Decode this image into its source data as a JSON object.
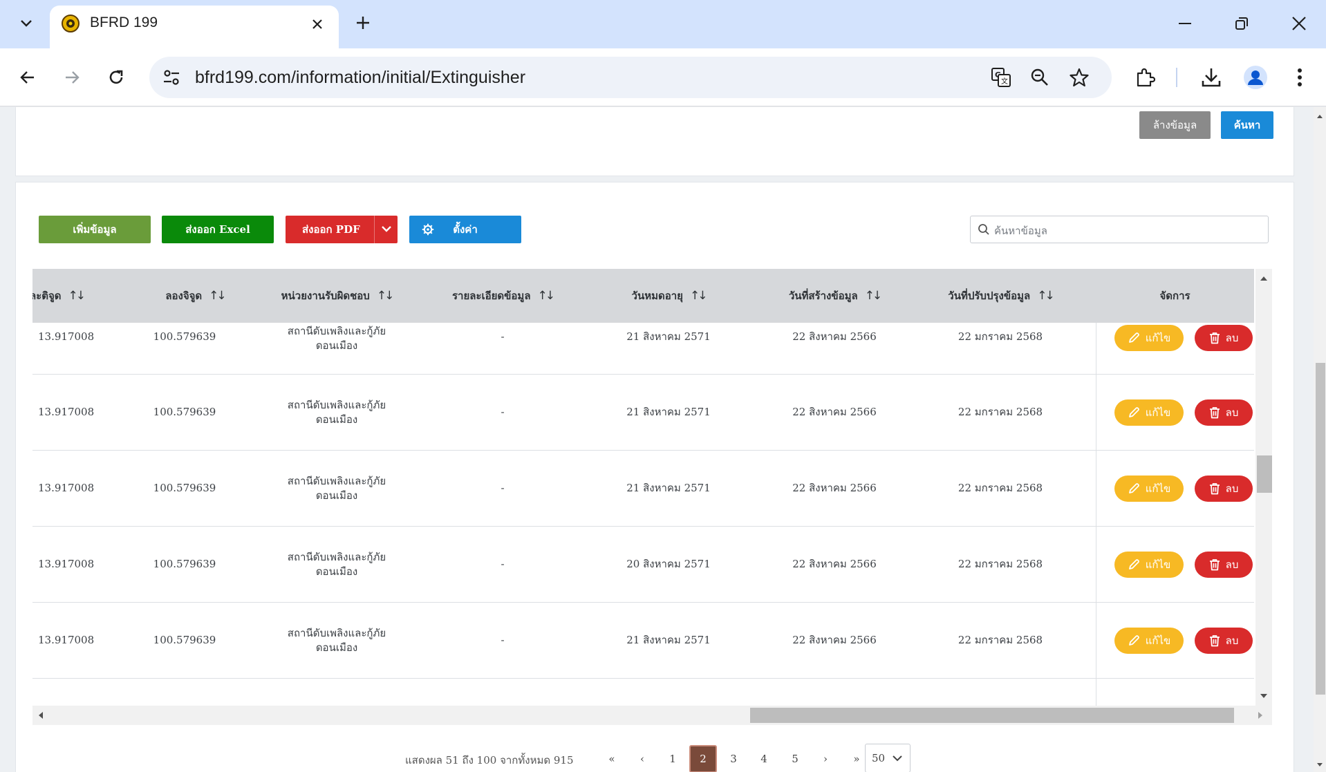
{
  "browser": {
    "tab_title": "BFRD 199",
    "url": "bfrd199.com/information/initial/Extinguisher"
  },
  "filter": {
    "clear_label": "ล้างข้อมูล",
    "search_label": "ค้นหา"
  },
  "actions": {
    "add_label": "เพิ่มข้อมูล",
    "excel_label": "ส่งออก Excel",
    "pdf_label": "ส่งออก PDF",
    "settings_label": "ตั้งค่า",
    "search_placeholder": "ค้นหาข้อมูล"
  },
  "table": {
    "headers": [
      "ละติจูด",
      "ลองจิจูด",
      "หน่วยงานรับผิดชอบ",
      "รายละเอียดข้อมูล",
      "วันหมดอายุ",
      "วันที่สร้างข้อมูล",
      "วันที่ปรับปรุงข้อมูล",
      "จัดการ"
    ],
    "edit_label": "แก้ไข",
    "delete_label": "ลบ",
    "rows": [
      {
        "lat": "13.917008",
        "lng": "100.579639",
        "agency_1": "สถานีดับเพลิงและกู้ภัย",
        "agency_2": "ดอนเมือง",
        "detail": "-",
        "expire": "21 สิงหาคม 2571",
        "created": "22 สิงหาคม 2566",
        "updated": "22 มกราคม 2568"
      },
      {
        "lat": "13.917008",
        "lng": "100.579639",
        "agency_1": "สถานีดับเพลิงและกู้ภัย",
        "agency_2": "ดอนเมือง",
        "detail": "-",
        "expire": "21 สิงหาคม 2571",
        "created": "22 สิงหาคม 2566",
        "updated": "22 มกราคม 2568"
      },
      {
        "lat": "13.917008",
        "lng": "100.579639",
        "agency_1": "สถานีดับเพลิงและกู้ภัย",
        "agency_2": "ดอนเมือง",
        "detail": "-",
        "expire": "21 สิงหาคม 2571",
        "created": "22 สิงหาคม 2566",
        "updated": "22 มกราคม 2568"
      },
      {
        "lat": "13.917008",
        "lng": "100.579639",
        "agency_1": "สถานีดับเพลิงและกู้ภัย",
        "agency_2": "ดอนเมือง",
        "detail": "-",
        "expire": "20 สิงหาคม 2571",
        "created": "22 สิงหาคม 2566",
        "updated": "22 มกราคม 2568"
      },
      {
        "lat": "13.917008",
        "lng": "100.579639",
        "agency_1": "สถานีดับเพลิงและกู้ภัย",
        "agency_2": "ดอนเมือง",
        "detail": "-",
        "expire": "21 สิงหาคม 2571",
        "created": "22 สิงหาคม 2566",
        "updated": "22 มกราคม 2568"
      }
    ]
  },
  "pagination": {
    "summary": "แสดงผล 51 ถึง 100 จากทั้งหมด 915",
    "first": "«",
    "prev": "‹",
    "pages": [
      "1",
      "2",
      "3",
      "4",
      "5"
    ],
    "current_page": "2",
    "next": "›",
    "last": "»",
    "page_size": "50"
  },
  "colors": {
    "add": "#6a9c3a",
    "excel": "#0a8a0a",
    "pdf": "#d92b2b",
    "settings": "#1a8ad8",
    "clear": "#8a8a8a",
    "search": "#1a8ad8",
    "edit": "#f7b924",
    "delete": "#d92b2b",
    "page_active": "#7a4a3a"
  }
}
